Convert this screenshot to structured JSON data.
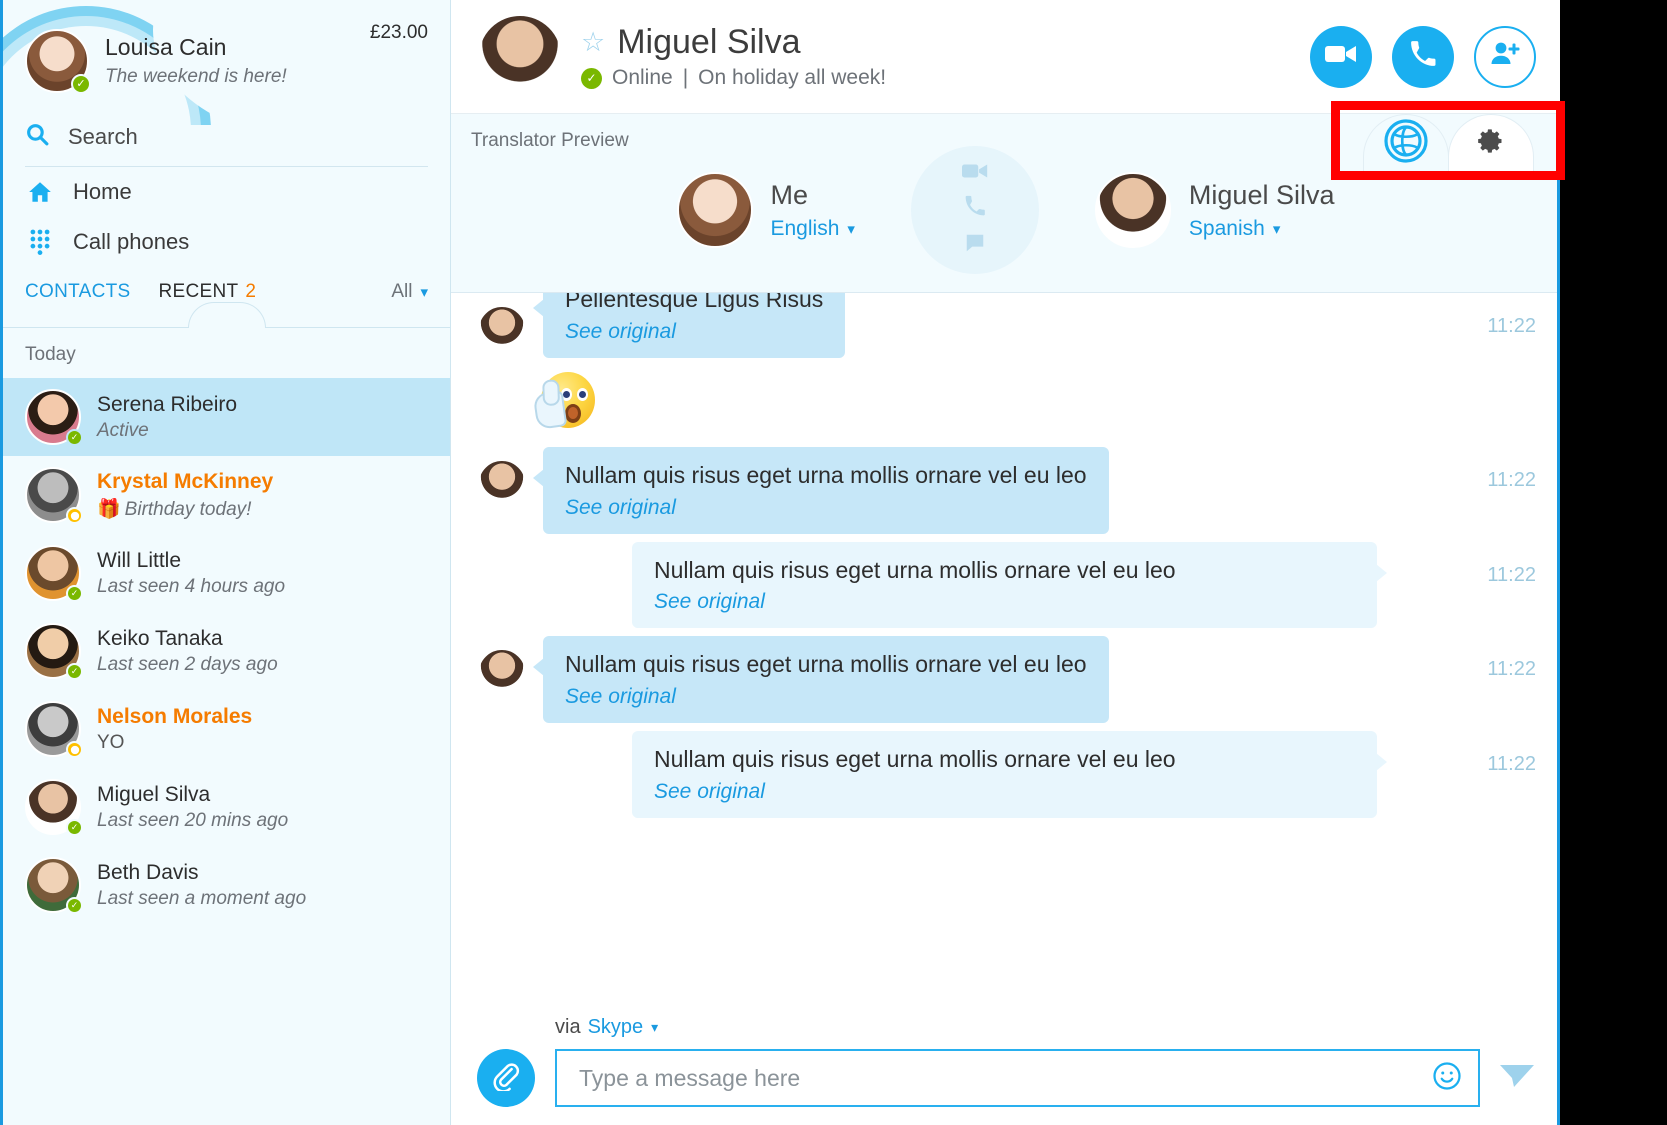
{
  "colors": {
    "brand_blue": "#1aaff0",
    "link_blue": "#1a9ae0",
    "highlight_orange": "#f57c00",
    "online_green": "#7ab800",
    "away_yellow": "#ffc000",
    "annotation_red": "#ff0000",
    "incoming_bubble": "#c6e7f8",
    "outgoing_bubble": "#e8f6fd",
    "sidebar_bg": "#f2fbfe",
    "selected_contact": "#bfe6f7"
  },
  "sidebar": {
    "profile": {
      "name": "Louisa Cain",
      "mood": "The weekend is here!",
      "credit": "£23.00",
      "status": "online"
    },
    "search": {
      "placeholder": "Search",
      "icon": "search-icon"
    },
    "nav": [
      {
        "label": "Home",
        "icon": "home-icon"
      },
      {
        "label": "Call phones",
        "icon": "dialpad-icon"
      }
    ],
    "tabs": {
      "contacts_label": "CONTACTS",
      "recent_label": "RECENT",
      "recent_count": "2",
      "filter_label": "All",
      "active": "RECENT"
    },
    "section_label": "Today",
    "contacts": [
      {
        "name": "Serena Ribeiro",
        "sub": "Active",
        "status": "online",
        "selected": true,
        "highlight": false,
        "gift": false
      },
      {
        "name": "Krystal McKinney",
        "sub": "Birthday today!",
        "status": "away",
        "selected": false,
        "highlight": true,
        "gift": true
      },
      {
        "name": "Will Little",
        "sub": "Last seen 4 hours ago",
        "status": "online",
        "selected": false,
        "highlight": false,
        "gift": false
      },
      {
        "name": "Keiko Tanaka",
        "sub": "Last seen 2 days ago",
        "status": "online",
        "selected": false,
        "highlight": false,
        "gift": false
      },
      {
        "name": "Nelson Morales",
        "sub": "YO",
        "status": "away",
        "selected": false,
        "highlight": true,
        "gift": false
      },
      {
        "name": "Miguel Silva",
        "sub": "Last seen 20 mins ago",
        "status": "online",
        "selected": false,
        "highlight": false,
        "gift": false
      },
      {
        "name": "Beth Davis",
        "sub": "Last seen a moment ago",
        "status": "online",
        "selected": false,
        "highlight": false,
        "gift": false
      }
    ]
  },
  "chat_header": {
    "contact_name": "Miguel Silva",
    "presence": "Online",
    "separator": "|",
    "mood": "On holiday all week!",
    "actions": [
      {
        "name": "video-call-button",
        "icon": "video-camera-icon"
      },
      {
        "name": "voice-call-button",
        "icon": "phone-icon"
      },
      {
        "name": "add-people-button",
        "icon": "add-person-icon"
      }
    ]
  },
  "translator_toolbar": {
    "globe_tab": {
      "icon": "globe-icon",
      "active": true
    },
    "settings_tab": {
      "icon": "gear-icon",
      "active": false
    }
  },
  "translator_panel": {
    "label": "Translator Preview",
    "me": {
      "name": "Me",
      "language": "English"
    },
    "other": {
      "name": "Miguel Silva",
      "language": "Spanish"
    },
    "center_icons": [
      "video-camera-icon",
      "phone-icon",
      "chat-bubble-icon"
    ]
  },
  "messages": [
    {
      "direction": "incoming",
      "text": "Pellentesque Ligus Risus",
      "see_original": "See original",
      "time": "11:22",
      "clipped": true
    },
    {
      "direction": "emoji",
      "emoji": "shushing-face-emoji",
      "time": ""
    },
    {
      "direction": "incoming",
      "text": "Nullam quis risus eget urna mollis ornare vel eu leo",
      "see_original": "See original",
      "time": "11:22"
    },
    {
      "direction": "outgoing",
      "text": "Nullam quis risus eget urna mollis ornare vel eu leo",
      "see_original": "See original",
      "time": "11:22"
    },
    {
      "direction": "incoming",
      "text": "Nullam quis risus eget urna mollis ornare vel eu leo",
      "see_original": "See original",
      "time": "11:22"
    },
    {
      "direction": "outgoing",
      "text": "Nullam quis risus eget urna mollis ornare vel eu leo",
      "see_original": "See original",
      "time": "11:22"
    }
  ],
  "composer": {
    "via_prefix": "via",
    "via_service": "Skype",
    "attach_icon": "paperclip-icon",
    "placeholder": "Type a message here",
    "value": "",
    "emoji_icon": "smiley-icon",
    "send_icon": "send-paper-plane-icon"
  }
}
